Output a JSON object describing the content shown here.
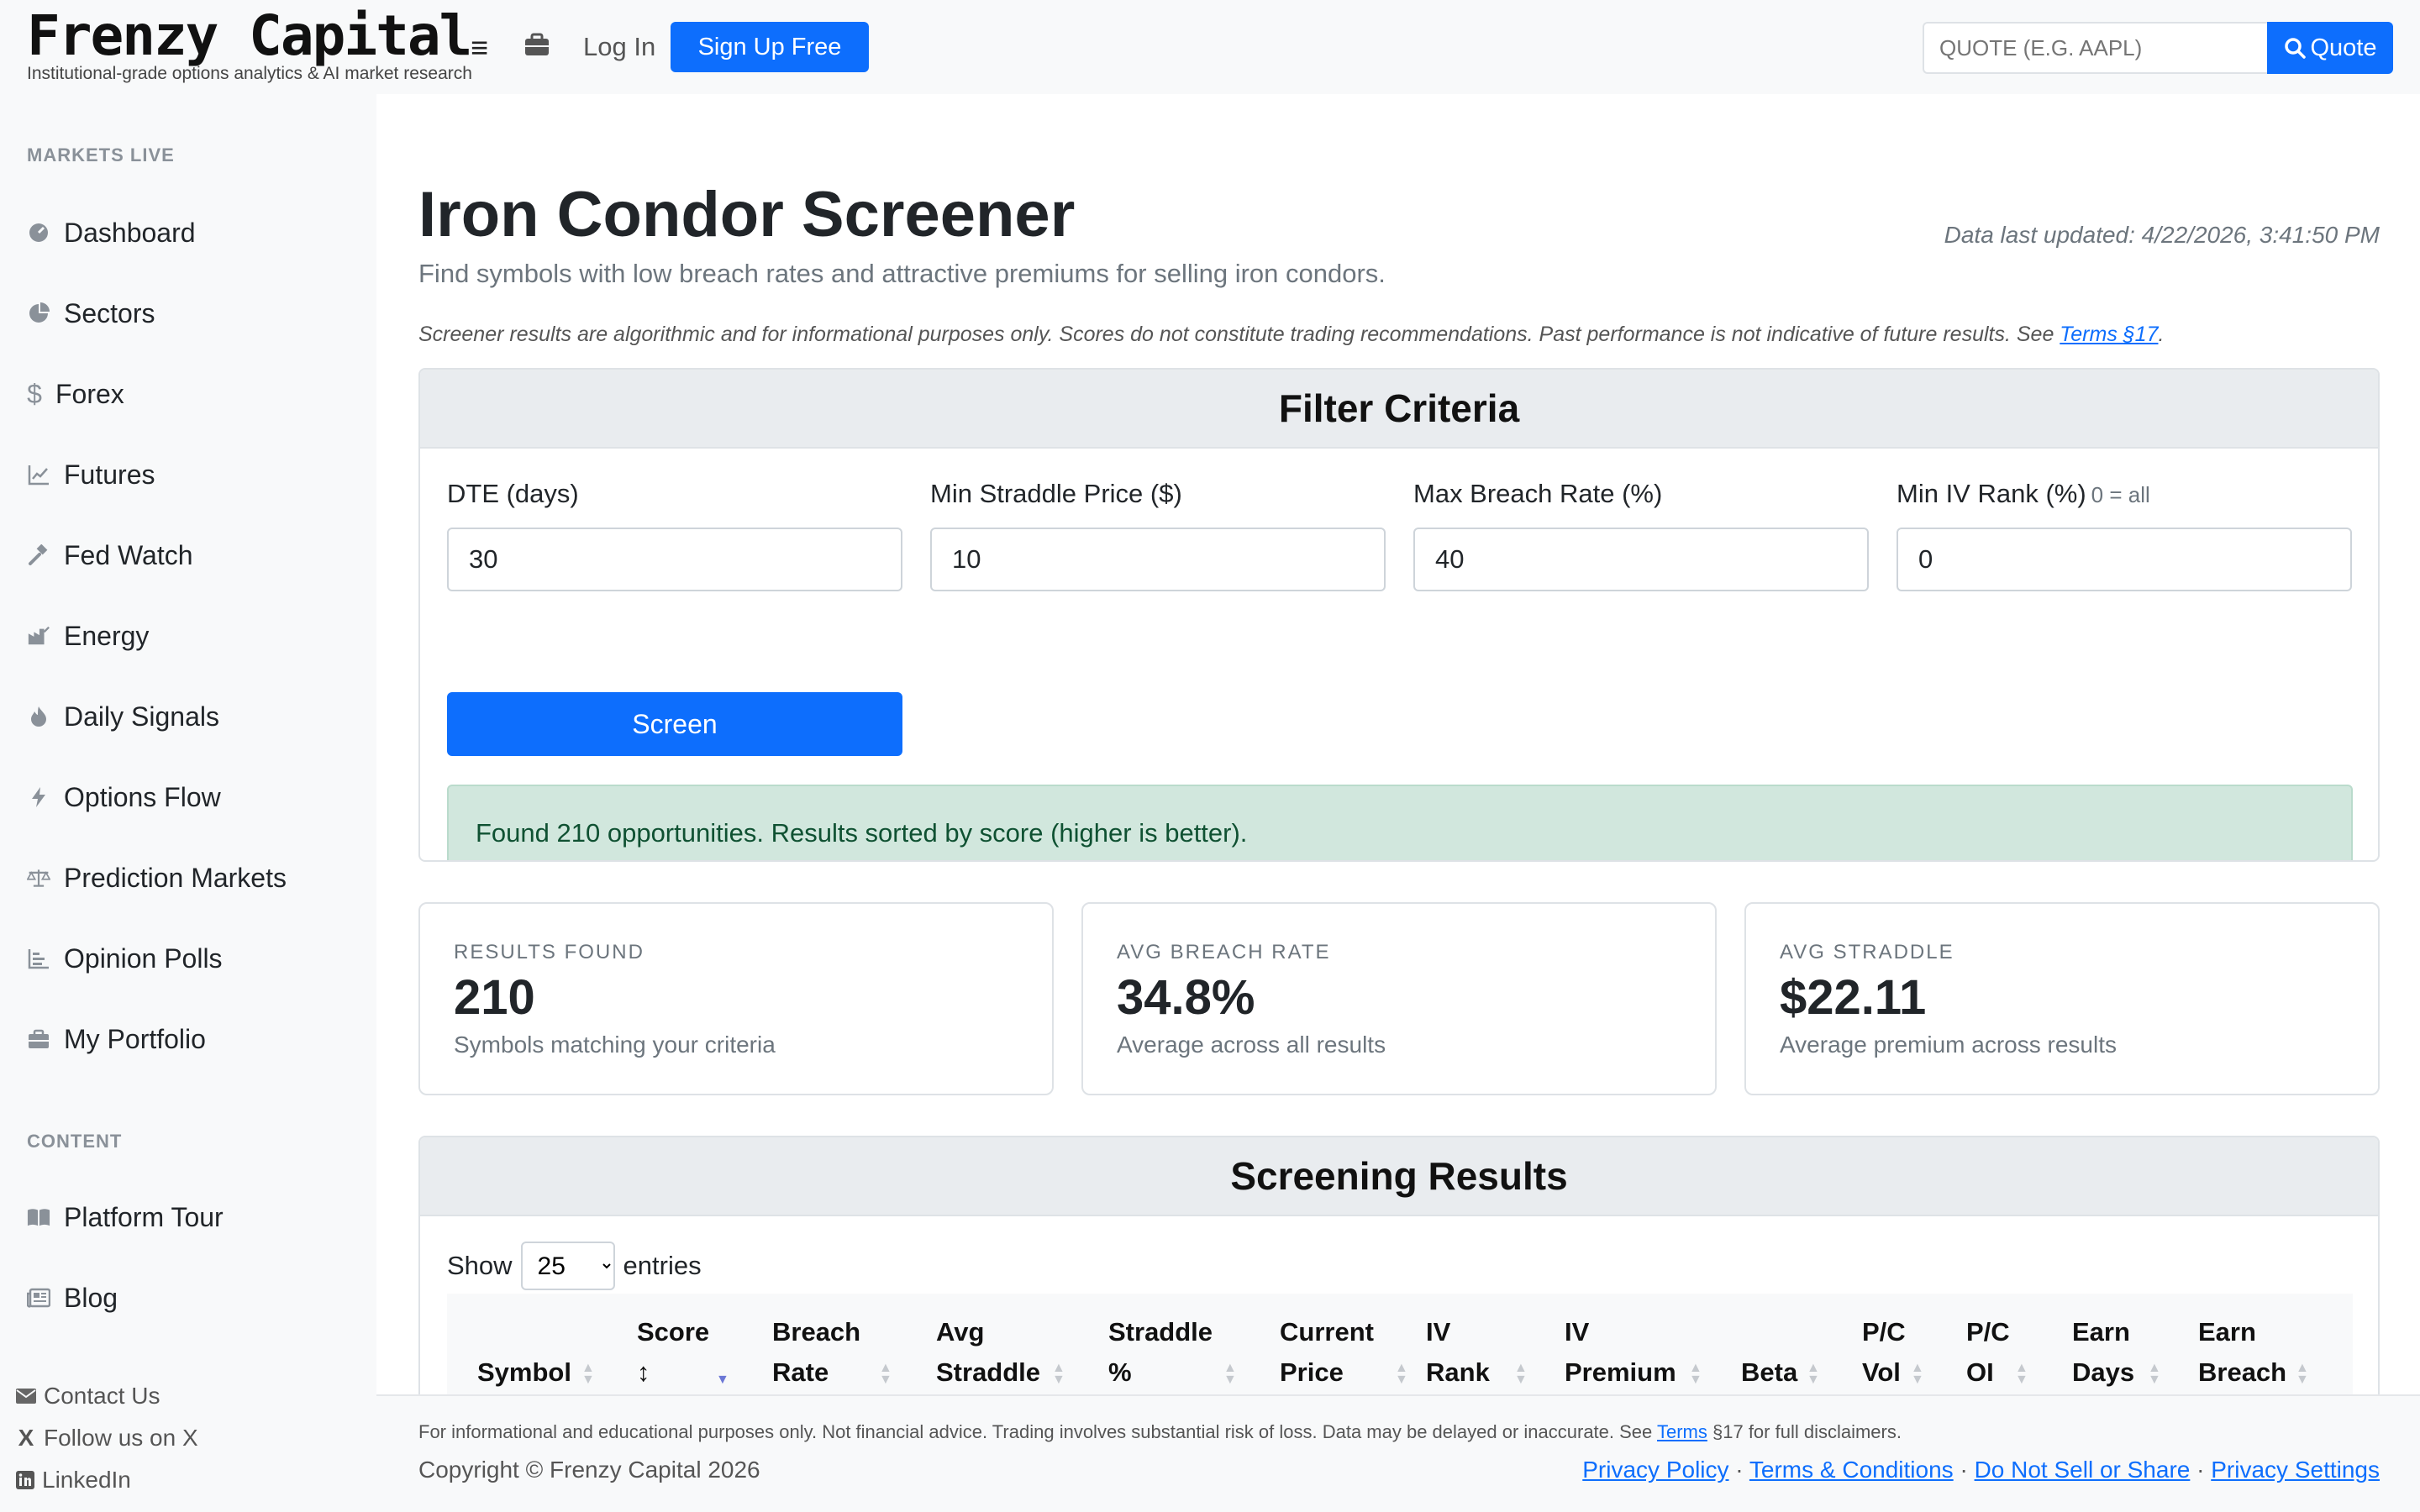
{
  "header": {
    "brand": "Frenzy Capital",
    "tagline": "Institutional-grade options analytics & AI market research",
    "login": "Log In",
    "signup": "Sign Up Free",
    "quote_placeholder": "QUOTE (E.G. AAPL)",
    "quote_button": "Quote"
  },
  "sidebar": {
    "section_markets": "MARKETS LIVE",
    "items": [
      {
        "label": "Dashboard",
        "icon": "dashboard-icon"
      },
      {
        "label": "Sectors",
        "icon": "pie-chart-icon"
      },
      {
        "label": "Forex",
        "icon": "dollar-icon"
      },
      {
        "label": "Futures",
        "icon": "line-chart-icon"
      },
      {
        "label": "Fed Watch",
        "icon": "gavel-icon"
      },
      {
        "label": "Energy",
        "icon": "industry-icon"
      },
      {
        "label": "Daily Signals",
        "icon": "fire-icon"
      },
      {
        "label": "Options Flow",
        "icon": "bolt-icon"
      },
      {
        "label": "Prediction Markets",
        "icon": "scale-icon"
      },
      {
        "label": "Opinion Polls",
        "icon": "bar-list-icon"
      },
      {
        "label": "My Portfolio",
        "icon": "briefcase-icon"
      }
    ],
    "section_content": "CONTENT",
    "content_items": [
      {
        "label": "Platform Tour",
        "icon": "book-icon"
      },
      {
        "label": "Blog",
        "icon": "newspaper-icon"
      }
    ],
    "links": [
      {
        "label": "Contact Us",
        "icon": "envelope-icon"
      },
      {
        "label": "Follow us on X",
        "icon": "x-logo-icon"
      },
      {
        "label": "LinkedIn",
        "icon": "linkedin-icon"
      }
    ]
  },
  "page": {
    "title": "Iron Condor Screener",
    "subtitle": "Find symbols with low breach rates and attractive premiums for selling iron condors.",
    "updated": "Data last updated: 4/22/2026, 3:41:50 PM",
    "disclaimer": "Screener results are algorithmic and for informational purposes only. Scores do not constitute trading recommendations. Past performance is not indicative of future results. See ",
    "disclaimer_link": "Terms §17",
    "disclaimer_end": "."
  },
  "filter": {
    "title": "Filter Criteria",
    "dte_label": "DTE (days)",
    "dte_value": "30",
    "straddle_label": "Min Straddle Price ($)",
    "straddle_value": "10",
    "breach_label": "Max Breach Rate (%)",
    "breach_value": "40",
    "ivrank_label": "Min IV Rank (%)",
    "ivrank_hint": "0 = all",
    "ivrank_value": "0",
    "screen_button": "Screen",
    "alert": "Found 210 opportunities. Results sorted by score (higher is better)."
  },
  "stats": [
    {
      "label": "RESULTS FOUND",
      "value": "210",
      "desc": "Symbols matching your criteria"
    },
    {
      "label": "AVG BREACH RATE",
      "value": "34.8%",
      "desc": "Average across all results"
    },
    {
      "label": "AVG STRADDLE",
      "value": "$22.11",
      "desc": "Average premium across results"
    }
  ],
  "results": {
    "title": "Screening Results",
    "show_label": "Show",
    "entries_value": "25",
    "entries_label": "entries",
    "columns": [
      {
        "l1": "",
        "l2": "Symbol"
      },
      {
        "l1": "Score",
        "l2": "↕"
      },
      {
        "l1": "Breach",
        "l2": "Rate"
      },
      {
        "l1": "Avg",
        "l2": "Straddle"
      },
      {
        "l1": "Straddle",
        "l2": "%"
      },
      {
        "l1": "Current",
        "l2": "Price"
      },
      {
        "l1": "IV",
        "l2": "Rank"
      },
      {
        "l1": "IV",
        "l2": "Premium"
      },
      {
        "l1": "",
        "l2": "Beta"
      },
      {
        "l1": "P/C",
        "l2": "Vol"
      },
      {
        "l1": "P/C",
        "l2": "OI"
      },
      {
        "l1": "Earn",
        "l2": "Days"
      },
      {
        "l1": "Earn",
        "l2": "Breach"
      }
    ]
  },
  "footer": {
    "note_pre": "For informational and educational purposes only. Not financial advice. Trading involves substantial risk of loss. Data may be delayed or inaccurate. See ",
    "note_link": "Terms",
    "note_post": " §17 for full disclaimers.",
    "copyright": "Copyright © Frenzy Capital 2026",
    "privacy": "Privacy Policy",
    "terms": "Terms & Conditions",
    "donotsell": "Do Not Sell or Share",
    "privacy_settings": "Privacy Settings",
    "sep": " · "
  },
  "colors": {
    "primary": "#0d6efd",
    "success_bg": "#d1e7dd",
    "success_text": "#0f5132",
    "muted": "#6c757d"
  }
}
